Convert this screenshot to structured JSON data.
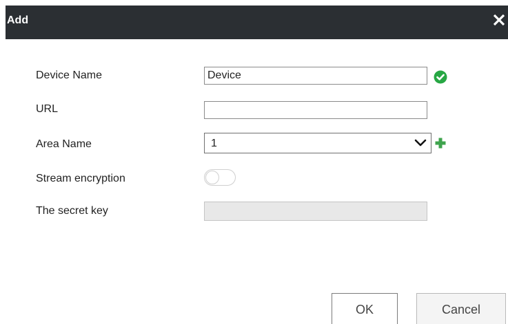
{
  "dialog": {
    "title": "Add",
    "close_icon": "close-icon"
  },
  "form": {
    "device_name": {
      "label": "Device Name",
      "value": "Device",
      "status_icon": "check-circle-icon",
      "status_color": "#27a744"
    },
    "url": {
      "label": "URL",
      "value": ""
    },
    "area_name": {
      "label": "Area Name",
      "selected": "1",
      "add_icon": "plus-icon",
      "add_color": "#3fa34d"
    },
    "stream_encryption": {
      "label": "Stream encryption",
      "enabled": false
    },
    "secret_key": {
      "label": "The secret key",
      "value": "",
      "disabled": true
    }
  },
  "buttons": {
    "ok_label": "OK",
    "cancel_label": "Cancel"
  },
  "colors": {
    "titlebar": "#2b2f33",
    "title_text": "#ffffff"
  }
}
